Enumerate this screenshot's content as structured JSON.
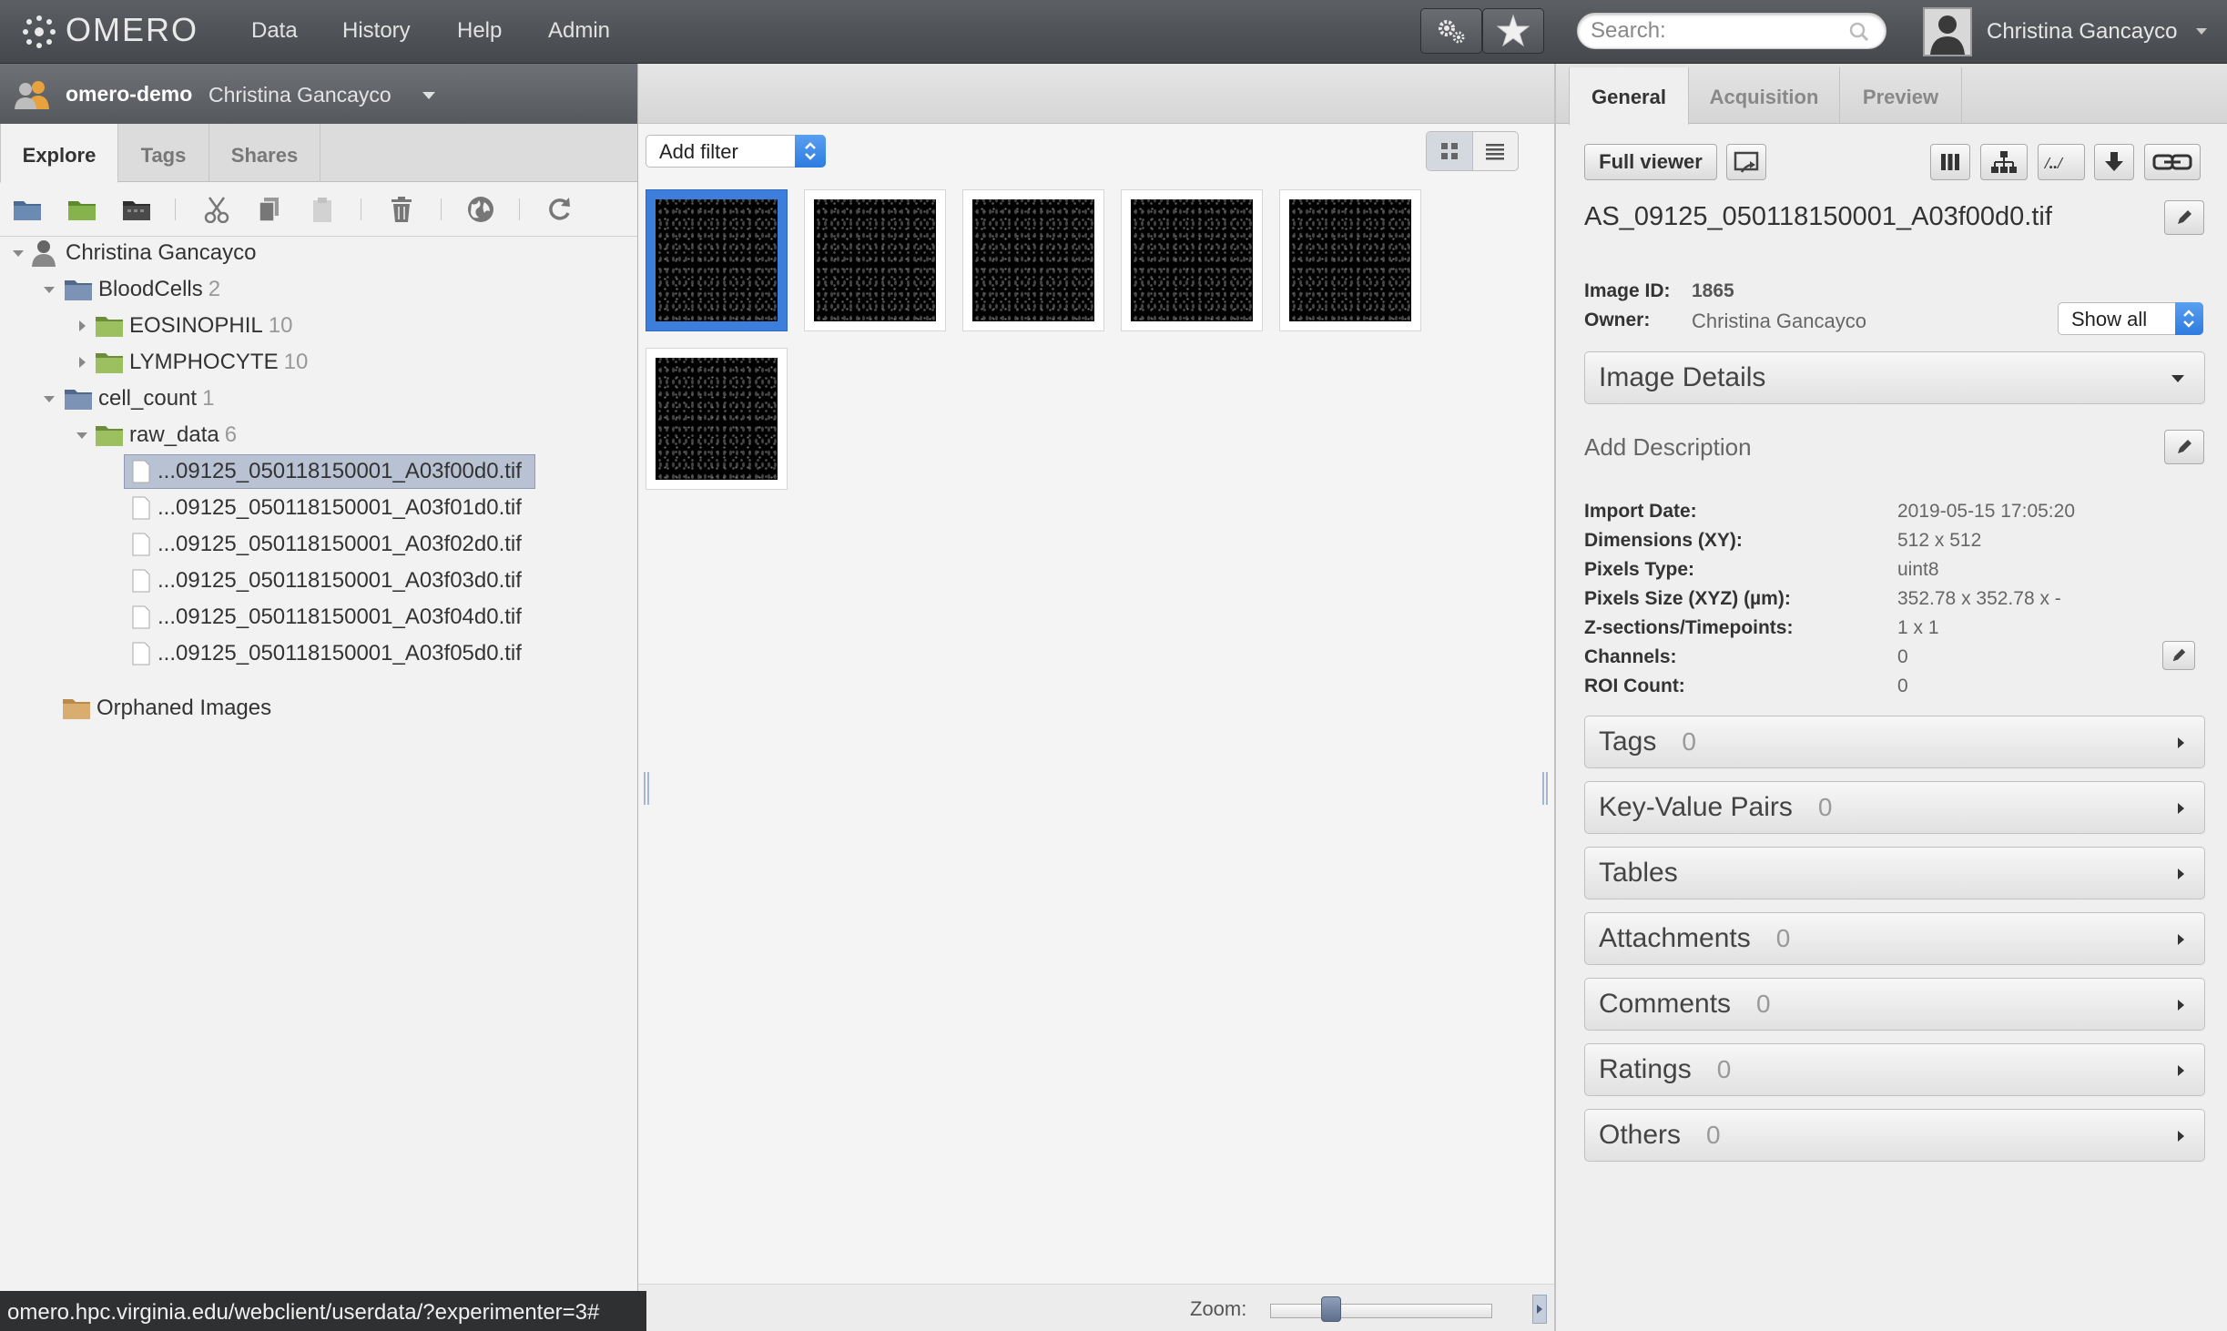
{
  "app": {
    "logo": "OMERO"
  },
  "topnav": {
    "items": [
      "Data",
      "History",
      "Help",
      "Admin"
    ]
  },
  "search": {
    "placeholder": "Search:"
  },
  "user": {
    "name": "Christina Gancayco"
  },
  "group_bar": {
    "group": "omero-demo",
    "user": "Christina Gancayco"
  },
  "left_tabs": [
    "Explore",
    "Tags",
    "Shares"
  ],
  "tree": {
    "root": "Christina Gancayco",
    "nodes": [
      {
        "label": "BloodCells",
        "count": "2"
      },
      {
        "label": "EOSINOPHIL",
        "count": "10"
      },
      {
        "label": "LYMPHOCYTE",
        "count": "10"
      },
      {
        "label": "cell_count",
        "count": "1"
      },
      {
        "label": "raw_data",
        "count": "6"
      },
      {
        "label": "...09125_050118150001_A03f00d0.tif"
      },
      {
        "label": "...09125_050118150001_A03f01d0.tif"
      },
      {
        "label": "...09125_050118150001_A03f02d0.tif"
      },
      {
        "label": "...09125_050118150001_A03f03d0.tif"
      },
      {
        "label": "...09125_050118150001_A03f04d0.tif"
      },
      {
        "label": "...09125_050118150001_A03f05d0.tif"
      },
      {
        "label": "Orphaned Images"
      }
    ]
  },
  "statusbar": {
    "url": "omero.hpc.virginia.edu/webclient/userdata/?experimenter=3#"
  },
  "center": {
    "filter_label": "Add filter",
    "zoom_label": "Zoom:",
    "zoom_level": 0.25
  },
  "right": {
    "tabs": [
      "General",
      "Acquisition",
      "Preview"
    ],
    "full_viewer": "Full viewer",
    "image_name": "AS_09125_050118150001_A03f00d0.tif",
    "image_id_label": "Image ID:",
    "image_id": "1865",
    "owner_label": "Owner:",
    "owner": "Christina Gancayco",
    "show_all": "Show all",
    "image_details": "Image Details",
    "add_description": "Add Description",
    "details": [
      {
        "key": "Import Date:",
        "value": "2019-05-15 17:05:20"
      },
      {
        "key": "Dimensions (XY):",
        "value": "512 x 512"
      },
      {
        "key": "Pixels Type:",
        "value": "uint8"
      },
      {
        "key": "Pixels Size (XYZ) (µm):",
        "value": "352.78 x 352.78 x -"
      },
      {
        "key": "Z-sections/Timepoints:",
        "value": "1 x 1"
      },
      {
        "key": "Channels:",
        "value": "0"
      },
      {
        "key": "ROI Count:",
        "value": "0"
      }
    ],
    "sections": [
      {
        "label": "Tags",
        "count": "0"
      },
      {
        "label": "Key-Value Pairs",
        "count": "0"
      },
      {
        "label": "Tables",
        "count": ""
      },
      {
        "label": "Attachments",
        "count": "0"
      },
      {
        "label": "Comments",
        "count": "0"
      },
      {
        "label": "Ratings",
        "count": "0"
      },
      {
        "label": "Others",
        "count": "0"
      }
    ]
  }
}
